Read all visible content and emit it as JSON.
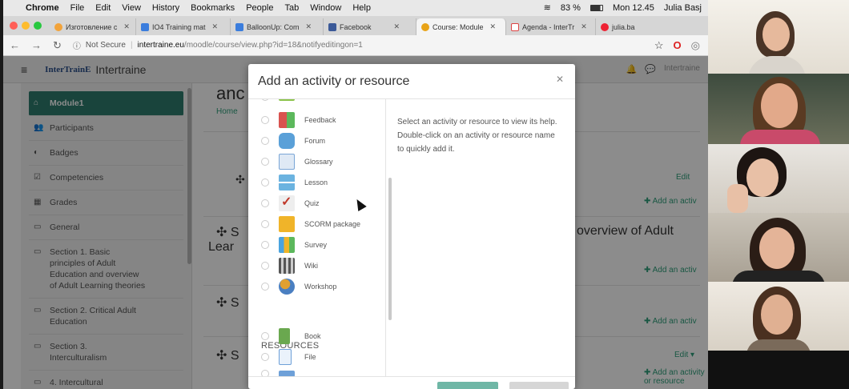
{
  "colors": {
    "moodle_green": "#2e7d6e",
    "link_green": "#2e9e7a",
    "overlay": "rgba(0,0,0,0.45)"
  },
  "menubar": {
    "app": "Chrome",
    "items": [
      "File",
      "Edit",
      "View",
      "History",
      "Bookmarks",
      "People",
      "Tab",
      "Window",
      "Help"
    ],
    "battery": "83 %",
    "clock": "Mon 12.45",
    "user": "Julia Basj"
  },
  "tabs": [
    {
      "label": "Изготовление с",
      "active": false,
      "color": "#f2a33a"
    },
    {
      "label": "IO4 Training mat",
      "active": false,
      "color": "#3b7ddd"
    },
    {
      "label": "BalloonUp: Com",
      "active": false,
      "color": "#3b7ddd"
    },
    {
      "label": "Facebook",
      "active": false,
      "color": "#3b5998"
    },
    {
      "label": "Course: Module",
      "active": true,
      "color": "#e8a317"
    },
    {
      "label": "Agenda - InterTr",
      "active": false,
      "color": "#d44"
    },
    {
      "label": "julia.ba",
      "active": false,
      "color": "#e23"
    }
  ],
  "address": {
    "security": "Not Secure",
    "host": "intertraine.eu",
    "path": "/moodle/course/view.php?id=18&notifyeditingon=1"
  },
  "moodle": {
    "logo": "InterTrainE",
    "site": "Intertraine",
    "user": "Intertraine"
  },
  "sidebar": {
    "items": [
      {
        "label": "Module1",
        "icon": "hat-icon",
        "glyph": "⌂",
        "active": true
      },
      {
        "label": "Participants",
        "icon": "users-icon",
        "glyph": "👥",
        "active": false
      },
      {
        "label": "Badges",
        "icon": "badge-icon",
        "glyph": "◐",
        "active": false
      },
      {
        "label": "Competencies",
        "icon": "check-icon",
        "glyph": "☑",
        "active": false
      },
      {
        "label": "Grades",
        "icon": "table-icon",
        "glyph": "▦",
        "active": false
      },
      {
        "label": "General",
        "icon": "folder-icon",
        "glyph": "▭",
        "active": false
      },
      {
        "label": "Section 1. Basic principles of Adult Education and overview of Adult Learning theories",
        "icon": "folder-icon",
        "glyph": "▭",
        "active": false
      },
      {
        "label": "Section 2. Critical Adult Education",
        "icon": "folder-icon",
        "glyph": "▭",
        "active": false
      },
      {
        "label": "Section 3. Interculturalism",
        "icon": "folder-icon",
        "glyph": "▭",
        "active": false
      },
      {
        "label": "4. Intercultural",
        "icon": "folder-icon",
        "glyph": "▭",
        "active": false
      }
    ]
  },
  "course": {
    "heading_partial": "anc",
    "breadcrumb": "Home",
    "edit": "Edit",
    "add_link": "Add an activity or resource",
    "add_link_partial": "Add an activ",
    "section_heading_partial": "overview of Adult",
    "lear_partial": "Lear",
    "s_partial": "S"
  },
  "modal": {
    "title": "Add an activity or resource",
    "help_text": "Select an activity or resource to view its help. Double-click on an activity or resource name to quickly add it.",
    "activities": [
      {
        "label": "Feedback",
        "icon": "feedback-icon",
        "color": "#d9534f"
      },
      {
        "label": "Forum",
        "icon": "forum-icon",
        "color": "#5aa0d8"
      },
      {
        "label": "Glossary",
        "icon": "glossary-icon",
        "color": "#7aa6d6"
      },
      {
        "label": "Lesson",
        "icon": "lesson-icon",
        "color": "#6bb3e0"
      },
      {
        "label": "Quiz",
        "icon": "quiz-icon",
        "color": "#c0392b"
      },
      {
        "label": "SCORM package",
        "icon": "scorm-icon",
        "color": "#f0b429"
      },
      {
        "label": "Survey",
        "icon": "survey-icon",
        "color": "#4aa3df"
      },
      {
        "label": "Wiki",
        "icon": "wiki-icon",
        "color": "#555555"
      },
      {
        "label": "Workshop",
        "icon": "workshop-icon",
        "color": "#e0a030"
      }
    ],
    "resources_heading": "RESOURCES",
    "resources": [
      {
        "label": "Book",
        "icon": "book-icon",
        "color": "#6aa84f"
      },
      {
        "label": "File",
        "icon": "file-icon",
        "color": "#6ea0d8"
      }
    ]
  }
}
